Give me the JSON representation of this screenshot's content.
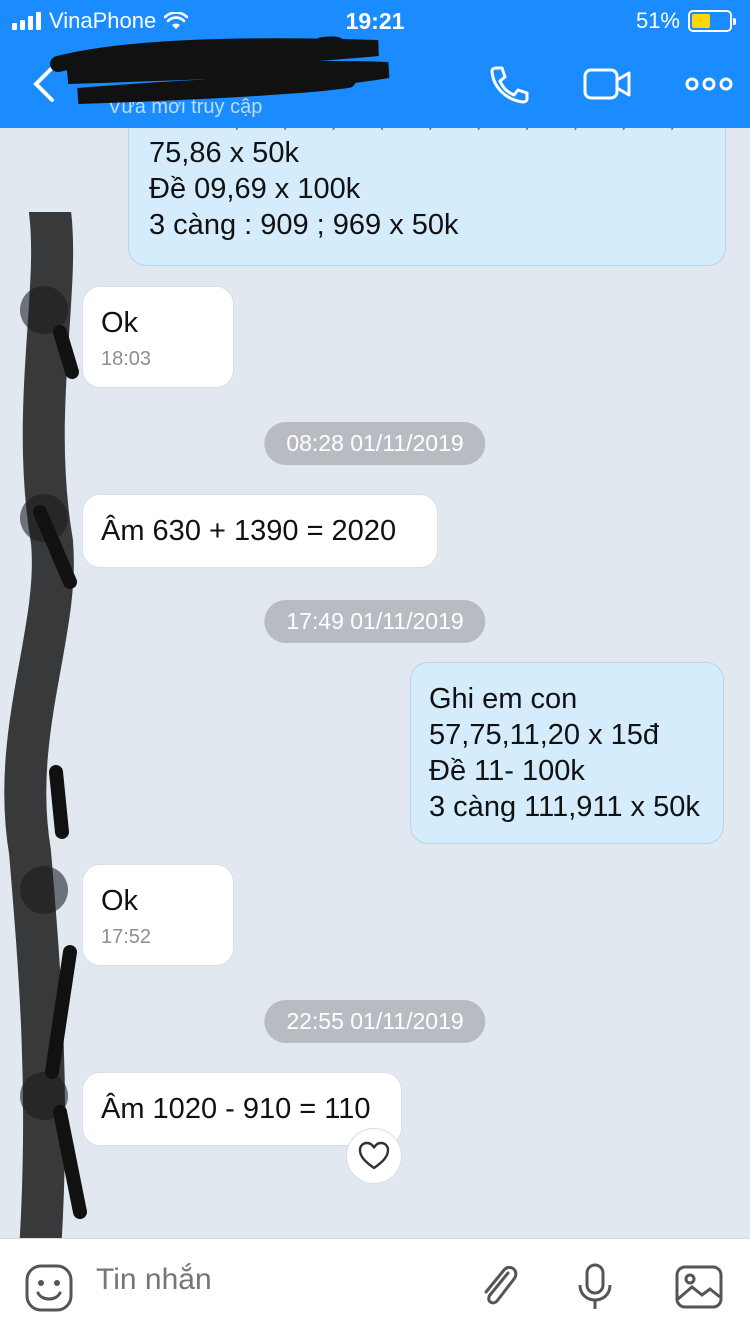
{
  "status_bar": {
    "carrier": "VinaPhone",
    "time": "19:21",
    "battery": "51%",
    "battery_level": 0.51
  },
  "header": {
    "subtitle": "Vừa mới truy cập",
    "icons": [
      "back-icon",
      "phone-icon",
      "video-icon",
      "more-icon"
    ]
  },
  "messages": [
    {
      "from": "me",
      "lines": [
        "75,86 x 50k",
        "Đề 09,69 x 100k",
        "3 càng : 909 ; 969 x 50k"
      ]
    },
    {
      "from": "them",
      "text": "Ok",
      "time": "18:03"
    },
    {
      "type": "separator",
      "text": "08:28 01/11/2019"
    },
    {
      "from": "them",
      "text": "Âm 630 + 1390 = 2020"
    },
    {
      "type": "separator",
      "text": "17:49 01/11/2019"
    },
    {
      "from": "me",
      "lines": [
        "Ghi em con",
        "57,75,11,20 x 15đ",
        "Đề 11- 100k",
        "3 càng 111,911 x 50k"
      ]
    },
    {
      "from": "them",
      "text": "Ok",
      "time": "17:52"
    },
    {
      "type": "separator",
      "text": "22:55 01/11/2019"
    },
    {
      "from": "them",
      "text": "Âm 1020 - 910 = 110"
    }
  ],
  "input": {
    "placeholder": "Tin nhắn",
    "icons": [
      "emoji-icon",
      "attach-icon",
      "microphone-icon",
      "image-icon"
    ]
  },
  "colors": {
    "header": "#1a8cff",
    "background": "#e2e8f0",
    "my_bubble": "#d5ecfd",
    "their_bubble": "#ffffff",
    "separator": "#b8bcc2"
  }
}
